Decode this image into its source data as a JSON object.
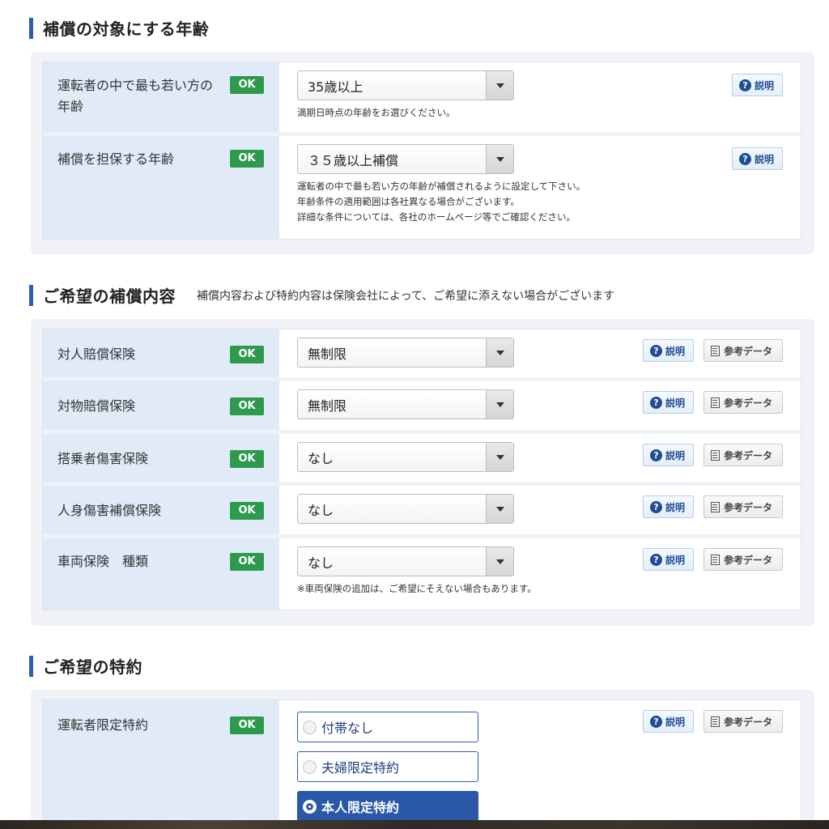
{
  "sections": {
    "age": {
      "title": "補償の対象にする年齢",
      "rows": [
        {
          "label": "運転者の中で最も若い方の年齢",
          "ok": "OK",
          "value": "35歳以上",
          "help": [
            "満期日時点の年齢をお選びください。"
          ]
        },
        {
          "label": "補償を担保する年齢",
          "ok": "OK",
          "value": "３５歳以上補償",
          "help": [
            "運転者の中で最も若い方の年齢が補償されるように設定して下さい。",
            "年齢条件の適用範囲は各社異なる場合がございます。",
            "詳細な条件については、各社のホームページ等でご確認ください。"
          ]
        }
      ]
    },
    "coverage": {
      "title": "ご希望の補償内容",
      "note": "補償内容および特約内容は保険会社によって、ご希望に添えない場合がございます",
      "rows": [
        {
          "label": "対人賠償保険",
          "ok": "OK",
          "value": "無制限"
        },
        {
          "label": "対物賠償保険",
          "ok": "OK",
          "value": "無制限"
        },
        {
          "label": "搭乗者傷害保険",
          "ok": "OK",
          "value": "なし"
        },
        {
          "label": "人身傷害補償保険",
          "ok": "OK",
          "value": "なし"
        },
        {
          "label": "車両保険　種類",
          "ok": "OK",
          "value": "なし",
          "help": "※車両保険の追加は、ご希望にそえない場合もあります。"
        }
      ]
    },
    "special": {
      "title": "ご希望の特約",
      "rows": [
        {
          "label": "運転者限定特約",
          "ok": "OK",
          "options": [
            "付帯なし",
            "夫婦限定特約",
            "本人限定特約"
          ],
          "selected": "本人限定特約"
        }
      ]
    }
  },
  "buttons": {
    "explain": "説明",
    "reference": "参考データ"
  },
  "icons": {
    "explain": "question-circle-icon",
    "reference": "document-icon",
    "select": "chevron-down-icon"
  },
  "colors": {
    "accent": "#2b5db4",
    "ok_badge": "#2d9a4e",
    "label_bg": "#e1ebf8",
    "selected_radio": "#2b57a9"
  }
}
